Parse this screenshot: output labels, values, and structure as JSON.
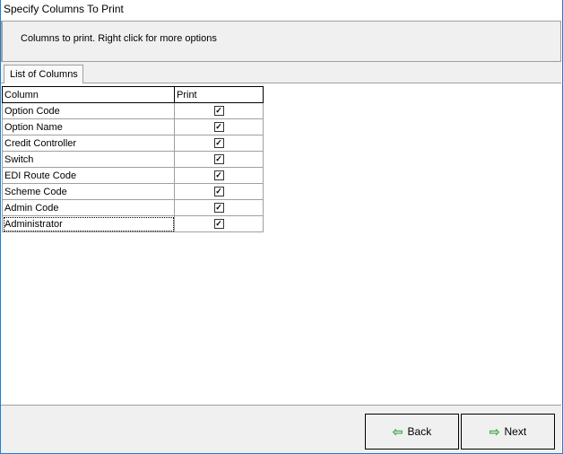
{
  "window": {
    "title": "Specify Columns To Print"
  },
  "header": {
    "instructions": "Columns to print.  Right click for more options"
  },
  "tabs": [
    {
      "label": "List of Columns"
    }
  ],
  "table": {
    "headers": [
      "Column",
      "Print"
    ],
    "rows": [
      {
        "column": "Option Code",
        "print": true
      },
      {
        "column": "Option Name",
        "print": true
      },
      {
        "column": "Credit Controller",
        "print": true
      },
      {
        "column": "Switch",
        "print": true
      },
      {
        "column": "EDI Route Code",
        "print": true
      },
      {
        "column": "Scheme Code",
        "print": true
      },
      {
        "column": "Admin Code",
        "print": true
      },
      {
        "column": "Administrator",
        "print": true
      }
    ]
  },
  "footer": {
    "back_label": "Back",
    "next_label": "Next"
  }
}
